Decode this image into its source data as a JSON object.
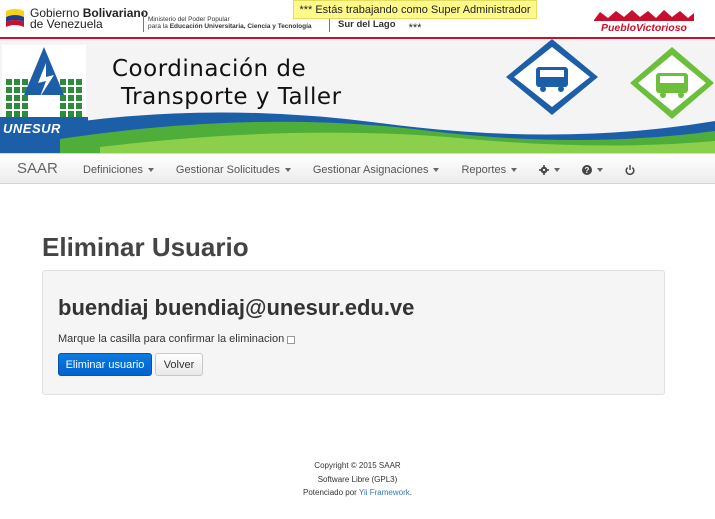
{
  "gov": {
    "name_prefix": "Gobierno ",
    "name_bold": "Bolivariano",
    "name_line2": "de Venezuela",
    "ministry_line1": "Ministerio del Poder Popular",
    "ministry_line2": "para la ",
    "ministry_line2_bold": "Educación Universitaria, Ciencia y Tecnología",
    "region": "Sur del Lago",
    "admin_notice": "*** Estás trabajando como Super Administrador ***",
    "pueblo_logo_text": "PuebloVictorioso"
  },
  "banner": {
    "title_line1": "Coordinación de",
    "title_line2": "Transporte y Taller",
    "logo_text": "UNESUR"
  },
  "navbar": {
    "brand": "SAAR",
    "menus": [
      {
        "label": "Definiciones"
      },
      {
        "label": "Gestionar Solicitudes"
      },
      {
        "label": "Gestionar Asignaciones"
      },
      {
        "label": "Reportes"
      }
    ],
    "icons": [
      "gear-icon",
      "question-icon",
      "power-icon"
    ]
  },
  "main": {
    "page_title": "Eliminar Usuario",
    "user_heading": "buendiaj buendiaj@unesur.edu.ve",
    "confirm_label": "Marque la casilla para confirmar la eliminacion",
    "confirm_checked": false,
    "delete_button": "Eliminar usuario",
    "back_button": "Volver"
  },
  "footer": {
    "copyright": "Copyright © 2015 SAAR",
    "license": "Software Libre (GPL3)",
    "powered_prefix": "Potenciado por ",
    "powered_link": "Yii Framework",
    "powered_suffix": "."
  },
  "colors": {
    "primary": "#0062cc",
    "accent_red": "#c8102e",
    "banner_green": "#4fae3a",
    "banner_blue": "#1c5fa8"
  }
}
